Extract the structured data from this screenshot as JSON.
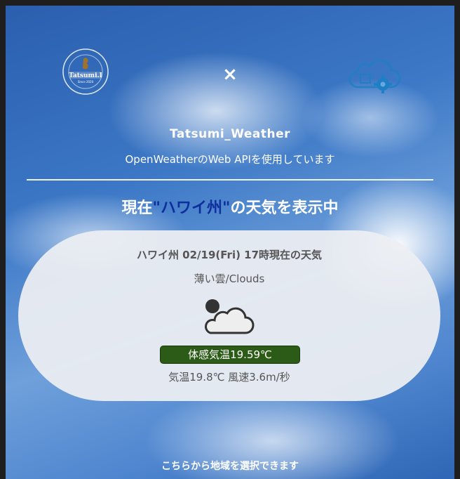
{
  "header": {
    "logo_left": {
      "icon": "tatsumi-logo-icon",
      "lines": [
        "Create & New",
        "Tatsumi.I",
        "Since 2020"
      ]
    },
    "close_icon": "×",
    "logo_right": {
      "icon": "cloud-gear-icon",
      "color": "#1f7fc4"
    }
  },
  "app": {
    "title": "Tatsumi_Weather",
    "subtitle": "OpenWeatherのWeb APIを使用しています"
  },
  "headline": {
    "prefix": "現在",
    "place": "\"ハワイ州\"",
    "suffix": "の天気を表示中",
    "place_color": "#0f2e9e"
  },
  "weather": {
    "title": "ハワイ州 02/19(Fri) 17時現在の天気",
    "description": "薄い雲/Clouds",
    "icon": "partly-cloudy-icon",
    "feels_like": "体感気温19.59℃",
    "feels_like_bg": "#2c5b17",
    "detail": "気温19.8℃ 風速3.6m/秒"
  },
  "footer": {
    "select_region": "こちらから地域を選択できます"
  }
}
